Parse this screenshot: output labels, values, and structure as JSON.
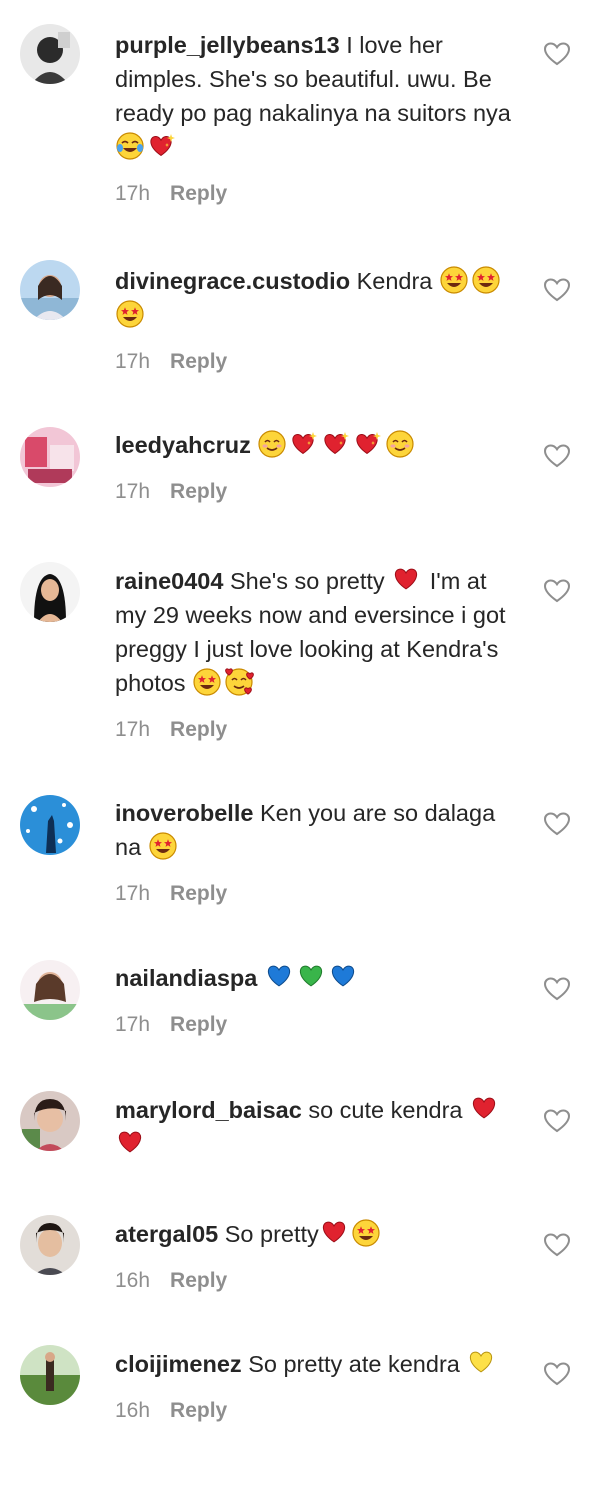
{
  "comments": [
    {
      "username": "purple_jellybeans13",
      "segments": [
        {
          "t": "text",
          "v": " I love her dimples. She's so beautiful. uwu. Be ready po pag nakalinya na suitors nya "
        },
        {
          "t": "emoji",
          "icon": "face-with-tears-of-joy"
        },
        {
          "t": "emoji",
          "icon": "sparkling-heart"
        }
      ],
      "time": "17h",
      "reply": "Reply",
      "avatar": "dark"
    },
    {
      "username": "divinegrace.custodio",
      "segments": [
        {
          "t": "text",
          "v": " Kendra "
        },
        {
          "t": "emoji",
          "icon": "star-struck"
        },
        {
          "t": "emoji",
          "icon": "star-struck"
        },
        {
          "t": "emoji",
          "icon": "star-struck"
        }
      ],
      "time": "17h",
      "reply": "Reply",
      "avatar": "sky"
    },
    {
      "username": "leedyahcruz",
      "segments": [
        {
          "t": "text",
          "v": " "
        },
        {
          "t": "emoji",
          "icon": "smiling-face"
        },
        {
          "t": "emoji",
          "icon": "sparkling-heart"
        },
        {
          "t": "emoji",
          "icon": "sparkling-heart"
        },
        {
          "t": "emoji",
          "icon": "sparkling-heart"
        },
        {
          "t": "emoji",
          "icon": "smiling-face"
        }
      ],
      "time": "17h",
      "reply": "Reply",
      "avatar": "pink"
    },
    {
      "username": "raine0404",
      "segments": [
        {
          "t": "text",
          "v": " She's so pretty "
        },
        {
          "t": "emoji",
          "icon": "red-heart"
        },
        {
          "t": "text",
          "v": " I'm at my 29 weeks now and eversince i got preggy I just love looking at Kendra's photos "
        },
        {
          "t": "emoji",
          "icon": "star-struck"
        },
        {
          "t": "emoji",
          "icon": "smiling-face-with-hearts"
        }
      ],
      "time": "17h",
      "reply": "Reply",
      "avatar": "portrait"
    },
    {
      "username": "inoverobelle",
      "segments": [
        {
          "t": "text",
          "v": " Ken you are so dalaga na "
        },
        {
          "t": "emoji",
          "icon": "star-struck"
        }
      ],
      "time": "17h",
      "reply": "Reply",
      "avatar": "blue"
    },
    {
      "username": "nailandiaspa",
      "segments": [
        {
          "t": "text",
          "v": " "
        },
        {
          "t": "emoji",
          "icon": "blue-heart"
        },
        {
          "t": "emoji",
          "icon": "green-heart"
        },
        {
          "t": "emoji",
          "icon": "blue-heart"
        }
      ],
      "time": "17h",
      "reply": "Reply",
      "avatar": "spa"
    },
    {
      "username": "marylord_baisac",
      "segments": [
        {
          "t": "text",
          "v": " so cute kendra "
        },
        {
          "t": "emoji",
          "icon": "red-heart"
        },
        {
          "t": "emoji",
          "icon": "red-heart"
        }
      ],
      "time": "",
      "reply": "",
      "avatar": "selfie"
    },
    {
      "username": "atergal05",
      "segments": [
        {
          "t": "text",
          "v": " So pretty"
        },
        {
          "t": "emoji",
          "icon": "red-heart"
        },
        {
          "t": "emoji",
          "icon": "star-struck"
        }
      ],
      "time": "16h",
      "reply": "Reply",
      "avatar": "face"
    },
    {
      "username": "cloijimenez",
      "segments": [
        {
          "t": "text",
          "v": " So pretty ate kendra "
        },
        {
          "t": "emoji",
          "icon": "yellow-heart"
        }
      ],
      "time": "16h",
      "reply": "Reply",
      "avatar": "outdoor"
    }
  ],
  "colors": {
    "text": "#262626",
    "muted": "#8e8e8e",
    "like_icon": "#8e8e8e"
  }
}
